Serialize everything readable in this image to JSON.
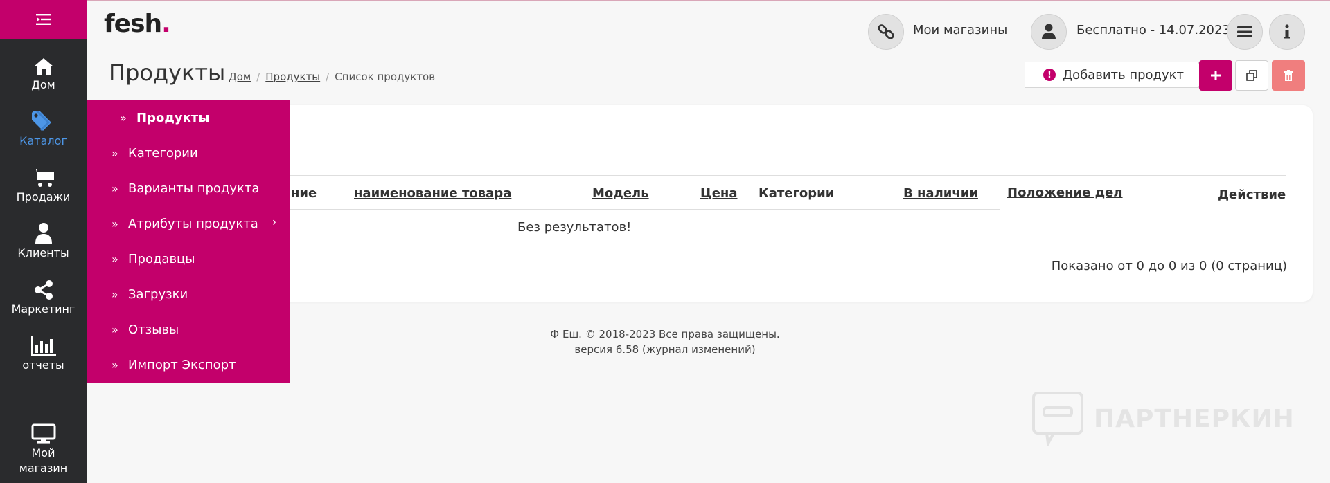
{
  "brand": {
    "logo_text": "fesh",
    "logo_dot": ".",
    "accent": "#c3006b"
  },
  "rail": {
    "items": [
      {
        "label": "Дом",
        "icon": "home-icon"
      },
      {
        "label": "Каталог",
        "icon": "tag-icon",
        "active": true
      },
      {
        "label": "Продажи",
        "icon": "cart-icon"
      },
      {
        "label": "Клиенты",
        "icon": "user-icon"
      },
      {
        "label": "Маркетинг",
        "icon": "share-icon"
      },
      {
        "label": "отчеты",
        "icon": "bar-chart-icon"
      },
      {
        "label": "Мой магазин",
        "icon": "monitor-icon"
      }
    ]
  },
  "flyout": {
    "items": [
      {
        "label": "Продукты"
      },
      {
        "label": "Категории"
      },
      {
        "label": "Варианты продукта"
      },
      {
        "label": "Атрибуты продукта",
        "has_submenu": true
      },
      {
        "label": "Продавцы"
      },
      {
        "label": "Загрузки"
      },
      {
        "label": "Отзывы"
      },
      {
        "label": "Импорт Экспорт"
      }
    ]
  },
  "header": {
    "stores_label": "Мои магазины",
    "plan_label": "Бесплатно - 14.07.2023"
  },
  "page": {
    "title": "Продукты",
    "breadcrumb": [
      "Дом",
      "Продукты",
      "Список продуктов"
    ]
  },
  "toolbar": {
    "add_product_label": "Добавить продукт"
  },
  "table": {
    "columns": [
      "ние",
      "наименование товара",
      "Модель",
      "Цена",
      "Категории",
      "В наличии",
      "Положение дел",
      "Действие"
    ],
    "empty_text": "Без результатов!",
    "pagination_text": "Показано от 0 до 0 из 0 (0 страниц)"
  },
  "footer": {
    "copyright": "Ф Еш. © 2018-2023 Все права защищены.",
    "version_prefix": "версия 6.58 (",
    "changelog_link": "журнал изменений",
    "version_suffix": ")"
  },
  "watermark": {
    "text": "ПАРТНЕРКИН"
  }
}
